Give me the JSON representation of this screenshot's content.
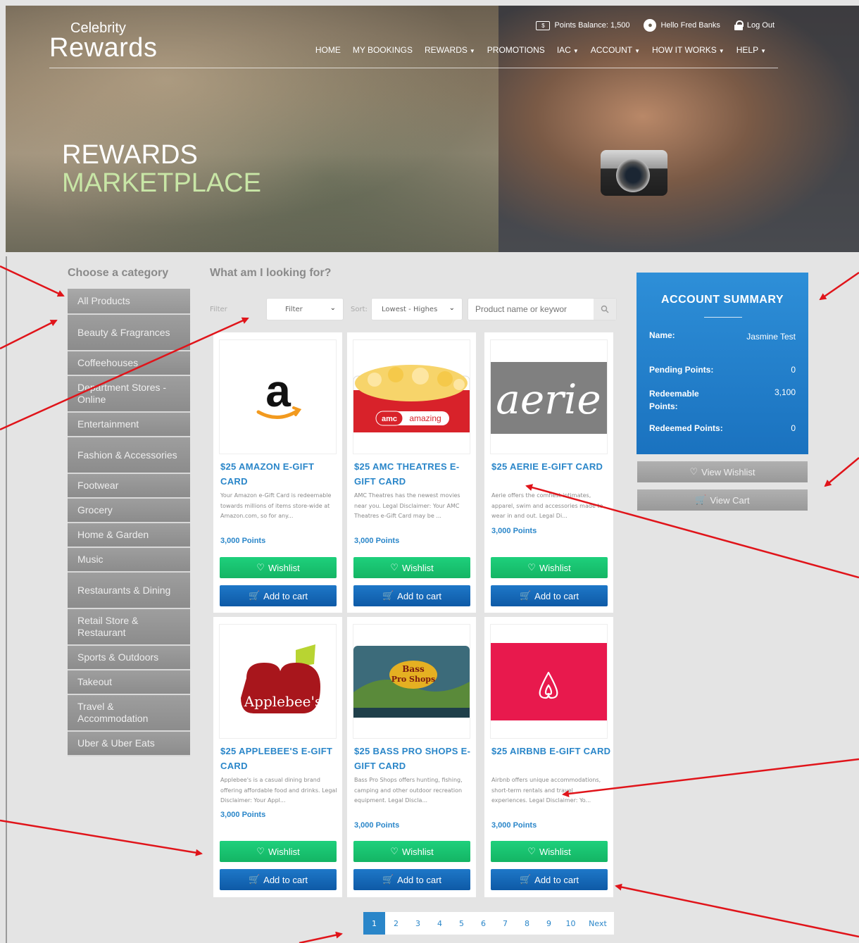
{
  "brand": {
    "line1": "Celebrity",
    "line2": "Rewards"
  },
  "topbar": {
    "points_balance": "Points Balance: 1,500",
    "greeting": "Hello Fred Banks",
    "logout": "Log Out"
  },
  "nav": [
    {
      "label": "HOME",
      "dropdown": false
    },
    {
      "label": "MY BOOKINGS",
      "dropdown": false
    },
    {
      "label": "REWARDS",
      "dropdown": true
    },
    {
      "label": "PROMOTIONS",
      "dropdown": false
    },
    {
      "label": "IAC",
      "dropdown": true
    },
    {
      "label": "ACCOUNT",
      "dropdown": true
    },
    {
      "label": "HOW IT WORKS",
      "dropdown": true
    },
    {
      "label": "HELP",
      "dropdown": true
    }
  ],
  "hero": {
    "title1": "REWARDS",
    "title2": "MARKETPLACE"
  },
  "categories": {
    "heading": "Choose a category",
    "items": [
      "All Products",
      "Beauty & Fragrances",
      "Coffeehouses",
      "Department Stores - Online",
      "Entertainment",
      "Fashion & Accessories",
      "Footwear",
      "Grocery",
      "Home & Garden",
      "Music",
      "Restaurants & Dining",
      "Retail Store & Restaurant",
      "Sports & Outdoors",
      "Takeout",
      "Travel & Accommodation",
      "Uber & Uber Eats"
    ]
  },
  "search_area": {
    "heading": "What am I looking for?",
    "filter_label": "Filter",
    "filter_value": "Filter",
    "sort_label": "Sort:",
    "sort_value": "Lowest - Highes",
    "search_placeholder": "Product name or keywor"
  },
  "products": [
    {
      "title": "$25 AMAZON E-GIFT CARD",
      "desc": "Your Amazon e-Gift Card is redeemable towards millions of items store-wide at Amazon.com, so for any...",
      "points": "3,000 Points",
      "logo": "amazon-logo"
    },
    {
      "title": "$25 AMC THEATRES E-GIFT CARD",
      "desc": "AMC Theatres has the newest movies near you. Legal Disclaimer: Your AMC Theatres e-Gift Card may be ...",
      "points": "3,000 Points",
      "logo": "amc-logo",
      "amc_text": "amazing"
    },
    {
      "title": "$25 AERIE E-GIFT CARD",
      "desc": "Aerie offers the comfiest intimates, apparel, swim and accessories made to wear in and out. Legal Di...",
      "points": "3,000 Points",
      "logo": "aerie-logo",
      "aerie_text": "aerie"
    },
    {
      "title": "$25 APPLEBEE'S E-GIFT CARD",
      "desc": "Applebee's is a casual dining brand offering affordable food and drinks. Legal Disclaimer: Your Appl...",
      "points": "3,000 Points",
      "logo": "applebees-logo",
      "logo_text": "Applebee's"
    },
    {
      "title": "$25 BASS PRO SHOPS E-GIFT CARD",
      "desc": "Bass Pro Shops offers hunting, fishing, camping and other outdoor recreation equipment. Legal Discla...",
      "points": "3,000 Points",
      "logo": "basspro-logo"
    },
    {
      "title": "$25 AIRBNB E-GIFT CARD",
      "desc": "Airbnb offers unique accommodations, short-term rentals and travel experiences. Legal Disclaimer: Yo...",
      "points": "3,000 Points",
      "logo": "airbnb-logo"
    }
  ],
  "buttons": {
    "wishlist": "Wishlist",
    "add_to_cart": "Add to cart"
  },
  "account_summary": {
    "heading": "ACCOUNT SUMMARY",
    "name_label": "Name:",
    "name_value": "Jasmine Test",
    "pending_label": "Pending Points:",
    "pending_value": "0",
    "redeemable_label": "Redeemable Points:",
    "redeemable_value": "3,100",
    "redeemed_label": "Redeemed Points:",
    "redeemed_value": "0",
    "view_wishlist": "View Wishlist",
    "view_cart": "View Cart"
  },
  "pagination": {
    "pages": [
      "1",
      "2",
      "3",
      "4",
      "5",
      "6",
      "7",
      "8",
      "9",
      "10"
    ],
    "current": "1",
    "next": "Next"
  },
  "colors": {
    "accent": "#2a86c9",
    "green": "#17c06e",
    "annotation": "#e0141a",
    "sidebar": "#959595"
  }
}
